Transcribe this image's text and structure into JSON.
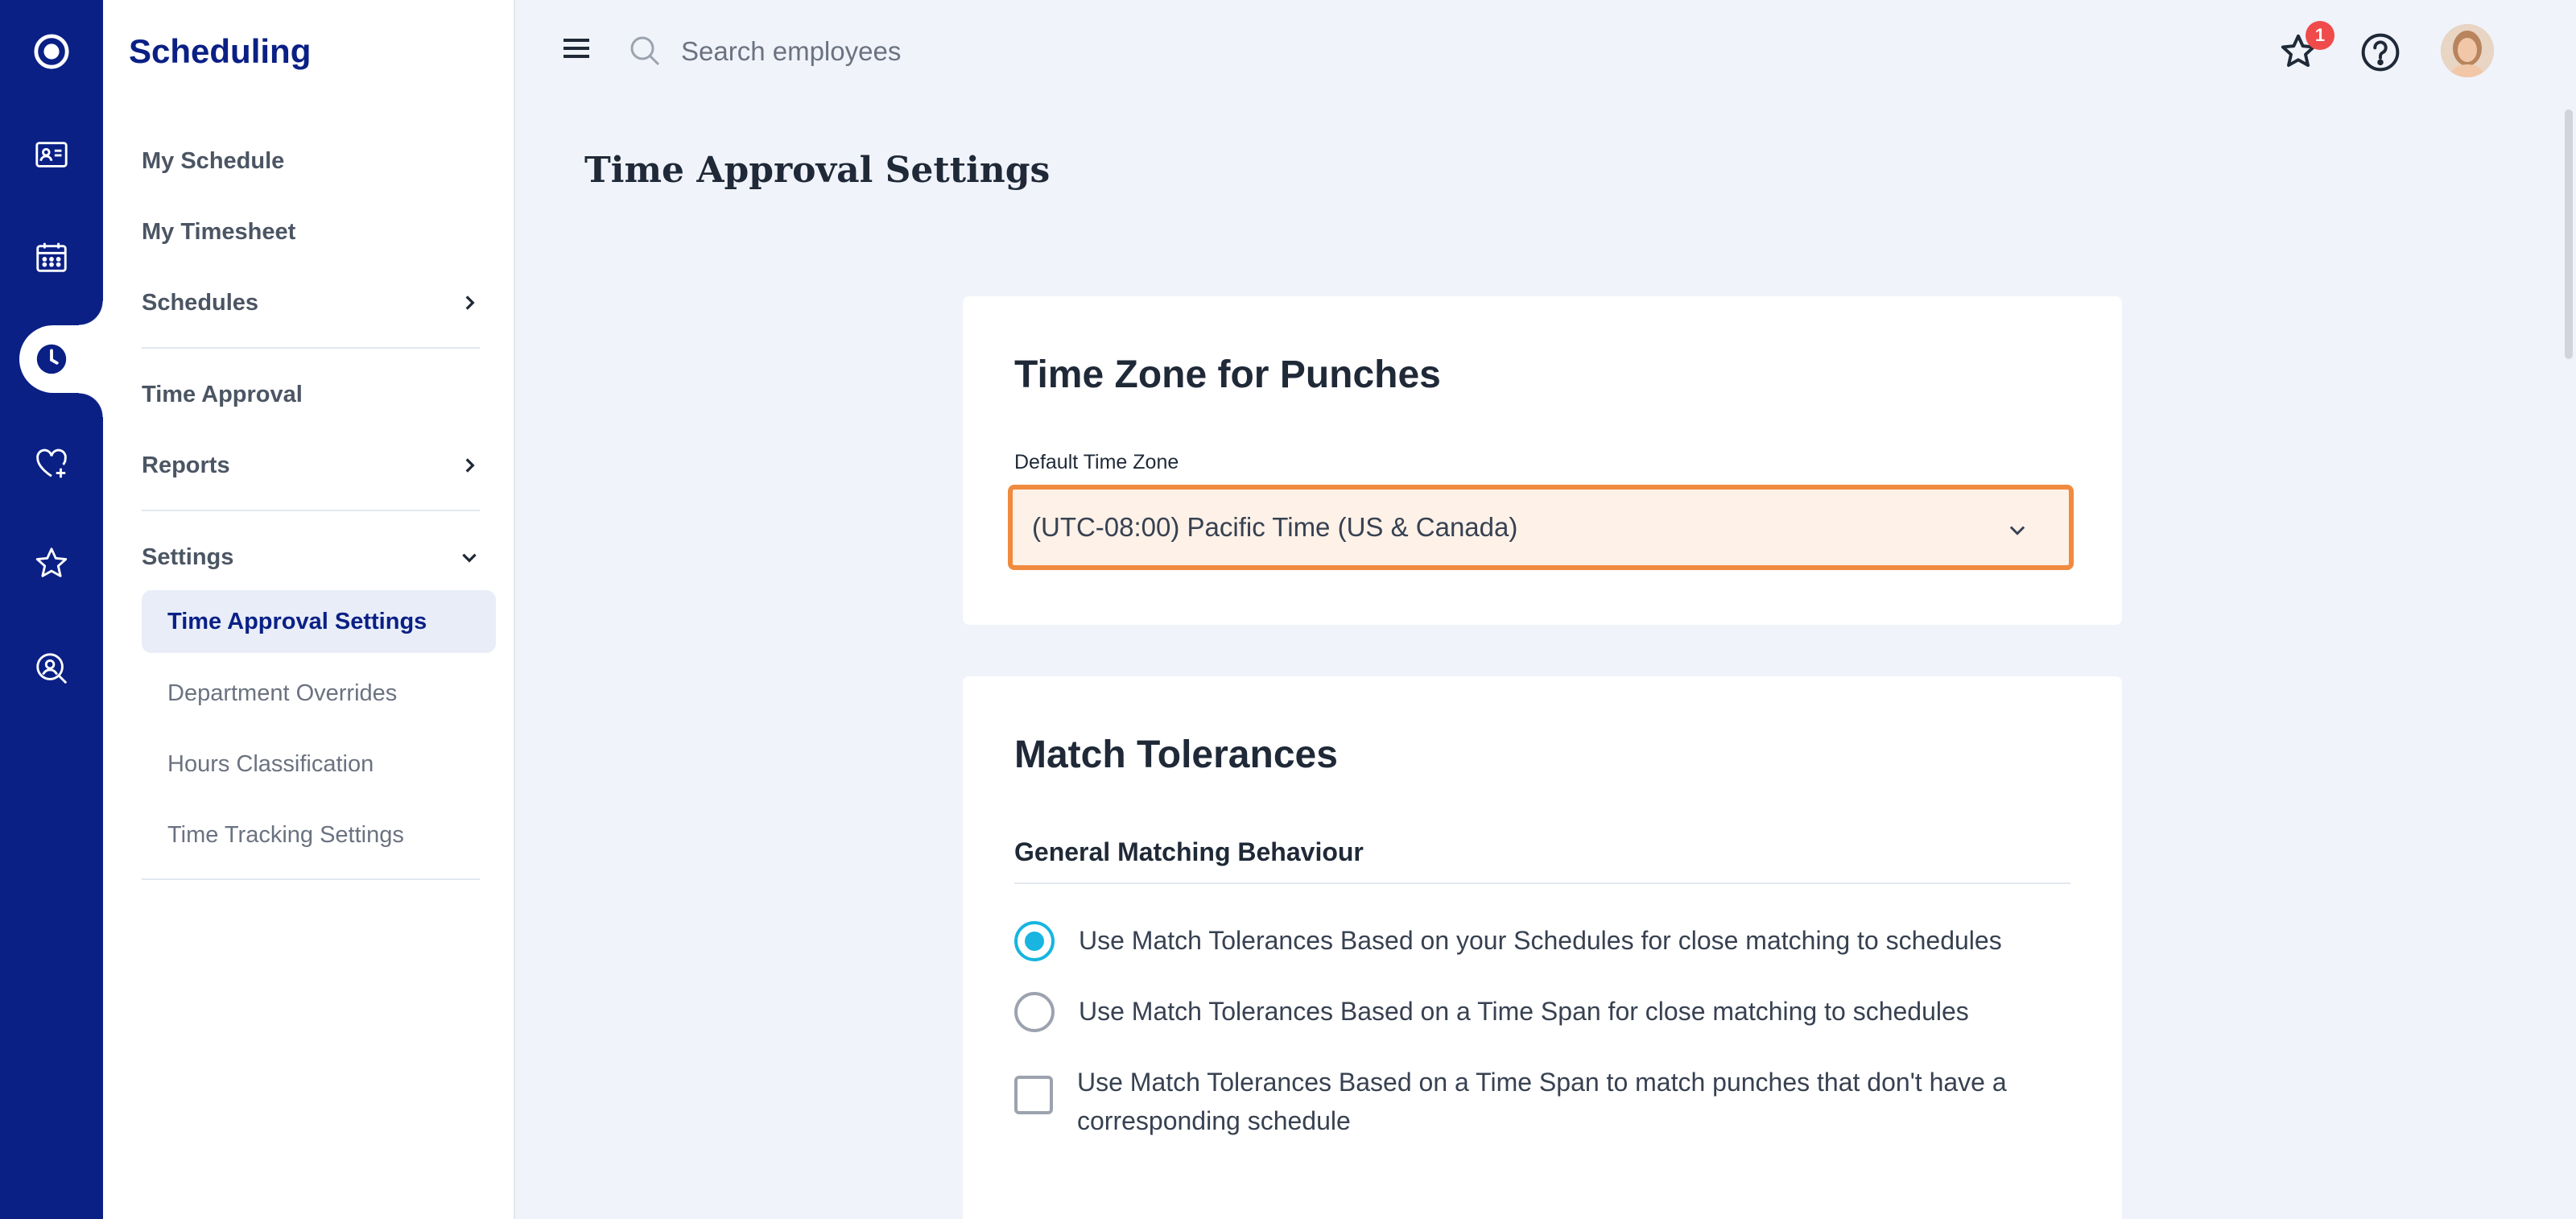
{
  "rail": {
    "items": [
      {
        "icon": "logo-icon"
      },
      {
        "icon": "contact-card-icon"
      },
      {
        "icon": "calendar-icon"
      },
      {
        "icon": "clock-icon",
        "active": true
      },
      {
        "icon": "heart-plus-icon"
      },
      {
        "icon": "star-icon"
      },
      {
        "icon": "person-search-icon"
      }
    ]
  },
  "sidebar": {
    "title": "Scheduling",
    "items": [
      {
        "label": "My Schedule"
      },
      {
        "label": "My Timesheet"
      },
      {
        "label": "Schedules",
        "icon": "chevron-right-icon"
      },
      {
        "label": "Time Approval"
      },
      {
        "label": "Reports",
        "icon": "chevron-right-icon"
      },
      {
        "label": "Settings",
        "icon": "chevron-down-icon"
      }
    ],
    "settings_sub": [
      {
        "label": "Time Approval Settings",
        "active": true
      },
      {
        "label": "Department Overrides"
      },
      {
        "label": "Hours Classification"
      },
      {
        "label": "Time Tracking Settings"
      }
    ]
  },
  "topbar": {
    "search_placeholder": "Search employees",
    "notifications_count": "1"
  },
  "page": {
    "title": "Time Approval Settings"
  },
  "time_zone_card": {
    "title": "Time Zone for Punches",
    "field_label": "Default Time Zone",
    "selected_value": "(UTC-08:00) Pacific Time (US & Canada)"
  },
  "match_card": {
    "title": "Match Tolerances",
    "section_label": "General Matching Behaviour",
    "options": [
      {
        "type": "radio",
        "checked": true,
        "label": "Use Match Tolerances Based on your Schedules for close matching to schedules"
      },
      {
        "type": "radio",
        "checked": false,
        "label": "Use Match Tolerances Based on a Time Span for close matching to schedules"
      },
      {
        "type": "checkbox",
        "checked": false,
        "label": "Use Match Tolerances Based on a Time Span to match punches that don't have a corresponding schedule"
      }
    ]
  },
  "colors": {
    "brand": "#0a2085",
    "accent": "#17b5e0",
    "focus_border": "#f08a3e",
    "badge": "#f04b4b"
  }
}
